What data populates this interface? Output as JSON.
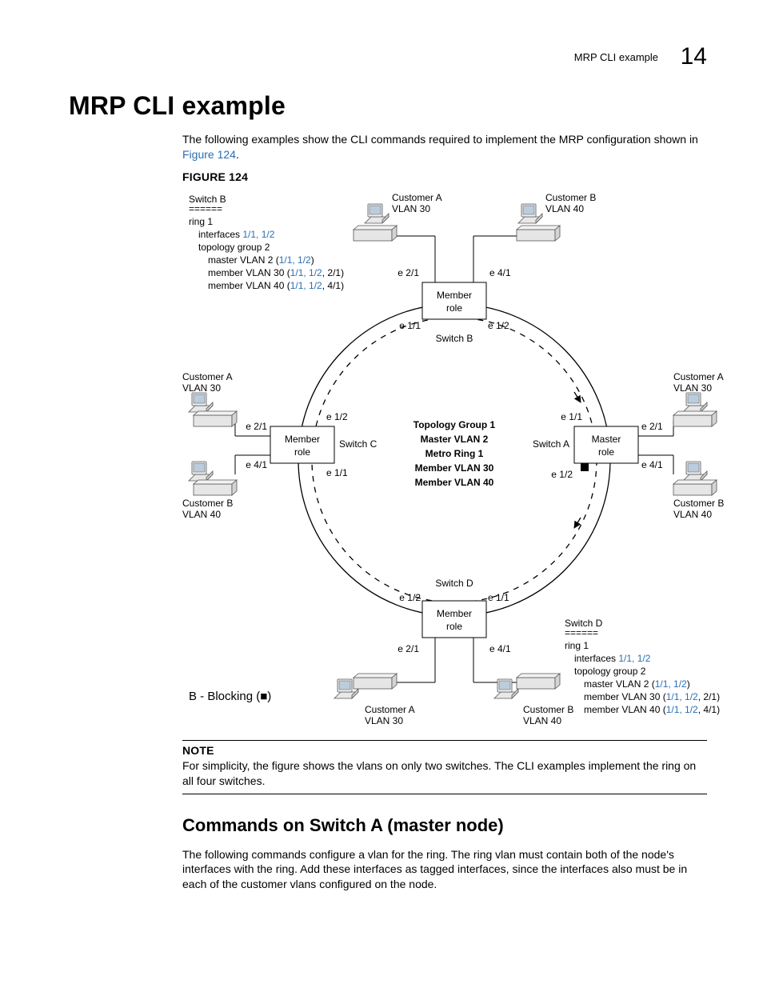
{
  "header": {
    "section": "MRP CLI example",
    "chapter_number": "14"
  },
  "title": "MRP CLI example",
  "intro_a": "The following examples show the CLI commands required to implement the MRP configuration shown in ",
  "intro_link": "Figure 124",
  "intro_b": ".",
  "figure_label": "FIGURE 124",
  "legend": "B - Blocking (■)",
  "note_label": "NOTE",
  "note_text": "For simplicity, the figure shows the vlans on only two switches. The CLI examples implement the ring on all four switches.",
  "subhead": "Commands on Switch A (master node)",
  "para": "The following commands configure a vlan for the ring. The ring vlan must contain both of the node's interfaces with the ring. Add these interfaces as tagged interfaces, since the interfaces also must be in each of the customer vlans configured on the node.",
  "figure": {
    "center": {
      "l1": "Topology Group 1",
      "l2": "Master VLAN 2",
      "l3": "Metro Ring 1",
      "l4": "Member VLAN 30",
      "l5": "Member VLAN 40"
    },
    "top": {
      "custA_a": "Customer A",
      "custA_b": "VLAN 30",
      "custB_a": "Customer B",
      "custB_b": "VLAN 40",
      "e21": "e 2/1",
      "e41": "e 4/1",
      "node1": "Member",
      "node2": "role",
      "e11": "e 1/1",
      "e12": "e 1/2",
      "switch": "Switch B"
    },
    "left": {
      "custA_a": "Customer A",
      "custA_b": "VLAN 30",
      "custB_a": "Customer B",
      "custB_b": "VLAN 40",
      "e21": "e 2/1",
      "e41": "e 4/1",
      "e12": "e 1/2",
      "e11": "e 1/1",
      "node1": "Member",
      "node2": "role",
      "switch": "Switch C"
    },
    "right": {
      "custA_a": "Customer A",
      "custA_b": "VLAN 30",
      "custB_a": "Customer B",
      "custB_b": "VLAN 40",
      "e21": "e 2/1",
      "e41": "e 4/1",
      "e11": "e 1/1",
      "e12": "e 1/2",
      "node1": "Master",
      "node2": "role",
      "switch": "Switch A"
    },
    "bottom": {
      "custA_a": "Customer A",
      "custA_b": "VLAN 30",
      "custB_a": "Customer B",
      "custB_b": "VLAN 40",
      "e21": "e 2/1",
      "e41": "e 4/1",
      "e12": "e 1/2",
      "e11": "e 1/1",
      "node1": "Member",
      "node2": "role",
      "switch": "Switch D"
    },
    "config_b": {
      "title": "Switch B",
      "sep": "======",
      "ring": "ring 1",
      "iface_pre": "interfaces ",
      "iface_link": "1/1, 1/2",
      "topo": "topology group 2",
      "mv_pre": "master VLAN 2 (",
      "mv_link": "1/1, 1/2",
      "mv_post": ")",
      "m30_pre": "member VLAN 30 (",
      "m30_link": "1/1, 1/2",
      "m30_post": ", 2/1)",
      "m40_pre": "member VLAN 40 (",
      "m40_link": "1/1, 1/2",
      "m40_post": ", 4/1)"
    },
    "config_d": {
      "title": "Switch D",
      "sep": "======",
      "ring": "ring 1",
      "iface_pre": "interfaces ",
      "iface_link": "1/1, 1/2",
      "topo": "topology group 2",
      "mv_pre": "master VLAN 2 (",
      "mv_link": "1/1, 1/2",
      "mv_post": ")",
      "m30_pre": "member VLAN 30 (",
      "m30_link": "1/1, 1/2",
      "m30_post": ", 2/1)",
      "m40_pre": "member VLAN 40 (",
      "m40_link": "1/1, 1/2",
      "m40_post": ", 4/1)"
    }
  }
}
